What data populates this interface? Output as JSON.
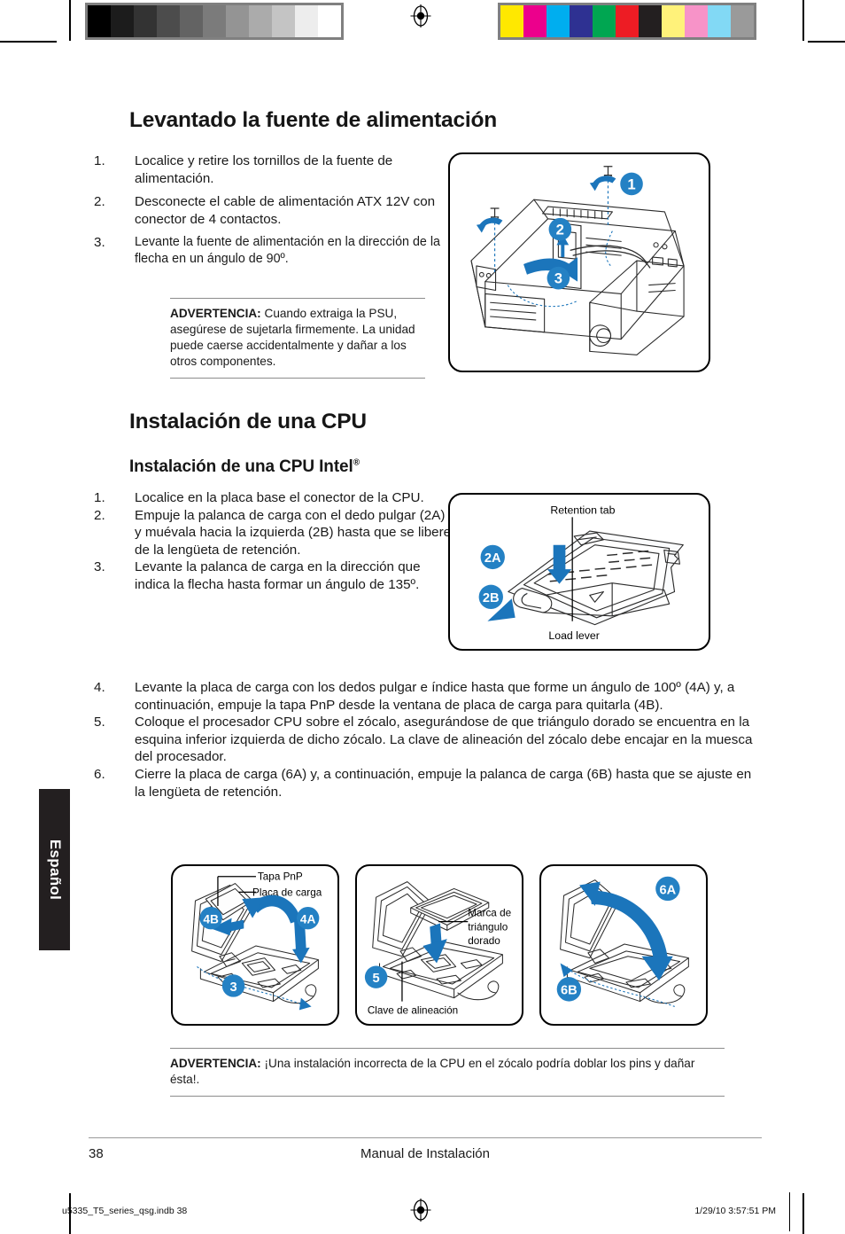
{
  "document": {
    "language_tab": "Español",
    "page_number": "38",
    "footer_title": "Manual de Instalación",
    "imprint_file": "u5335_T5_series_qsg.indb   38",
    "imprint_timestamp": "1/29/10   3:57:51 PM"
  },
  "colors": {
    "accent_blue": "#1b75bb",
    "callout_blue": "#2481c4",
    "tab_black": "#231f20",
    "rule_gray": "#8c8c8c"
  },
  "calibration": {
    "grayscale_swatches": [
      "#000000",
      "#1c1c1c",
      "#333333",
      "#4c4c4c",
      "#636363",
      "#7b7b7b",
      "#949494",
      "#ababab",
      "#c4c4c4",
      "#ededed",
      "#ffffff"
    ],
    "color_swatches": [
      "#ffe800",
      "#ec008c",
      "#00aeef",
      "#2e3192",
      "#00a651",
      "#ed1c24",
      "#231f20",
      "#fff27a",
      "#f793c8",
      "#82d9f5",
      "#9a9a9a"
    ]
  },
  "section1": {
    "heading": "Levantado la fuente de alimentación",
    "steps": [
      {
        "num": "1.",
        "text": "Localice y retire los tornillos de la fuente de alimentación."
      },
      {
        "num": "2.",
        "text": "Desconecte el cable de alimentación ATX 12V con conector de 4 contactos."
      },
      {
        "num": "3.",
        "text": "Levante la fuente de alimentación en la dirección de la flecha en un ángulo de 90º."
      }
    ],
    "note_label": "ADVERTENCIA:",
    "note_text": " Cuando extraiga la PSU, asegúrese de sujetarla firmemente. La unidad puede caerse accidentalmente y dañar a los otros componentes.",
    "figure": {
      "name": "chassis-psu-removal",
      "callouts": [
        "1",
        "2",
        "3"
      ]
    }
  },
  "section2": {
    "heading": "Instalación de una CPU",
    "subheading": "Instalación de una CPU Intel",
    "subheading_sup": "®",
    "steps": [
      {
        "num": "1.",
        "text": "Localice en la placa base el conector de la CPU."
      },
      {
        "num": "2.",
        "text": "Empuje la palanca de carga con el dedo pulgar (2A) y muévala hacia la izquierda (2B) hasta que se libere de la lengüeta de retención."
      },
      {
        "num": "3.",
        "text": "Levante la palanca de carga en la dirección que indica la flecha hasta formar un ángulo de 135º."
      },
      {
        "num": "4.",
        "text": "Levante la placa de carga con los dedos pulgar e índice hasta que forme un ángulo de 100º (4A) y, a continuación, empuje la tapa PnP desde la ventana de placa de carga para quitarla (4B)."
      },
      {
        "num": "5.",
        "text": "Coloque el procesador CPU sobre el zócalo, asegurándose de que triángulo dorado se encuentra en la esquina inferior izquierda de dicho zócalo. La clave de alineación del zócalo debe encajar en la muesca del procesador."
      },
      {
        "num": "6.",
        "text": "Cierre la placa de carga (6A) y, a continuación, empuje la palanca de carga (6B) hasta que se ajuste en la lengüeta de retención."
      }
    ],
    "note_label": "ADVERTENCIA:",
    "note_text": " ¡Una instalación incorrecta de la CPU en el zócalo podría doblar los pins y dañar ésta!.",
    "figure_socket": {
      "name": "cpu-socket-load-lever",
      "label_top": "Retention tab",
      "label_bottom": "Load lever",
      "callouts": [
        "2A",
        "2B"
      ]
    },
    "figure_4": {
      "name": "cpu-load-plate-pnp-cap",
      "label_top": "Tapa PnP",
      "label_second": "Placa de carga",
      "callouts": [
        "4B",
        "4A",
        "3"
      ]
    },
    "figure_5": {
      "name": "cpu-placement-alignment",
      "label_right": "Marca de triángulo dorado",
      "label_bottom": "Clave de alineación",
      "callouts": [
        "5"
      ]
    },
    "figure_6": {
      "name": "cpu-close-load-plate",
      "callouts": [
        "6A",
        "6B"
      ]
    }
  }
}
